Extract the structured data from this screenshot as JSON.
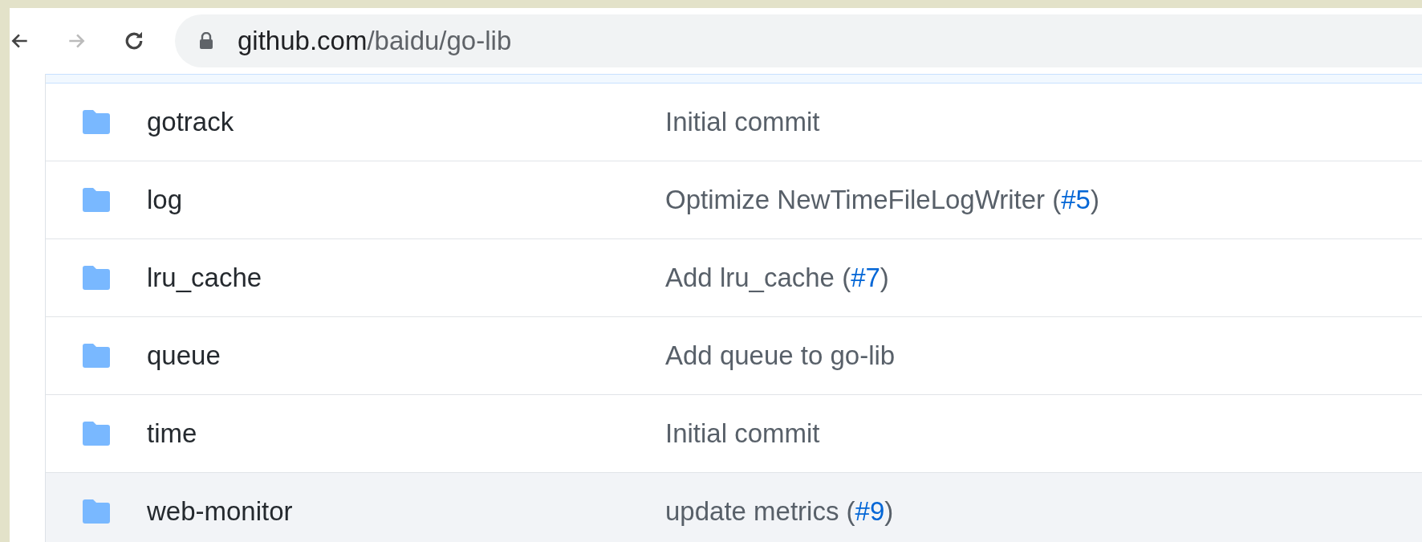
{
  "address_bar": {
    "host": "github.com",
    "path": "/baidu/go-lib"
  },
  "rows": [
    {
      "name": "gotrack",
      "message": "Initial commit",
      "highlighted": false
    },
    {
      "name": "log",
      "message": "Optimize NewTimeFileLogWriter (",
      "link": "#5",
      "message_end": ")",
      "highlighted": false
    },
    {
      "name": "lru_cache",
      "message": "Add lru_cache (",
      "link": "#7",
      "message_end": ")",
      "highlighted": false
    },
    {
      "name": "queue",
      "message": "Add queue to go-lib",
      "highlighted": false
    },
    {
      "name": "time",
      "message": "Initial commit",
      "highlighted": false
    },
    {
      "name": "web-monitor",
      "message": "update metrics (",
      "link": "#9",
      "message_end": ")",
      "highlighted": true
    }
  ]
}
